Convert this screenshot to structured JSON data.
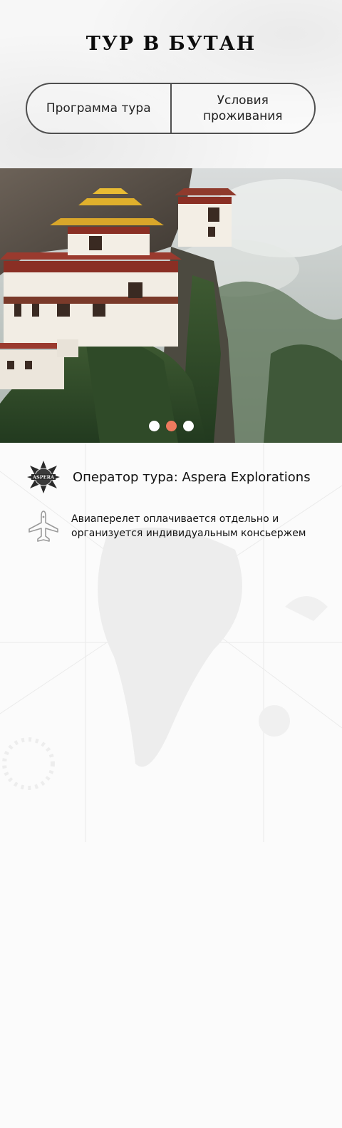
{
  "header": {
    "title": "ТУР В БУТАН"
  },
  "tabs": [
    {
      "label": "Программа тура"
    },
    {
      "label": "Условия проживания"
    }
  ],
  "carousel": {
    "slide_count": 3,
    "active_index": 1,
    "active_color": "#ee7a5e",
    "dot_color": "#ffffff"
  },
  "info": {
    "operator": {
      "icon": "aspera-logo-icon",
      "logo_text": "ASPERA",
      "text": "Оператор тура: Aspera Explorations"
    },
    "flight": {
      "icon": "airplane-icon",
      "text": "Авиаперелет оплачивается отдельно и организуется индивидуальным консьержем"
    }
  }
}
